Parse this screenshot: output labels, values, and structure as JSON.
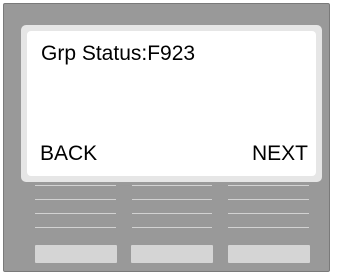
{
  "display": {
    "line1": "Grp Status:F923",
    "softkey_left": "BACK",
    "softkey_right": "NEXT"
  },
  "colors": {
    "housing": "#999999",
    "screen_bezel": "#e6e6e6",
    "screen": "#ffffff",
    "grille": "#d2d2d2",
    "keys": "#d5d5d5"
  }
}
